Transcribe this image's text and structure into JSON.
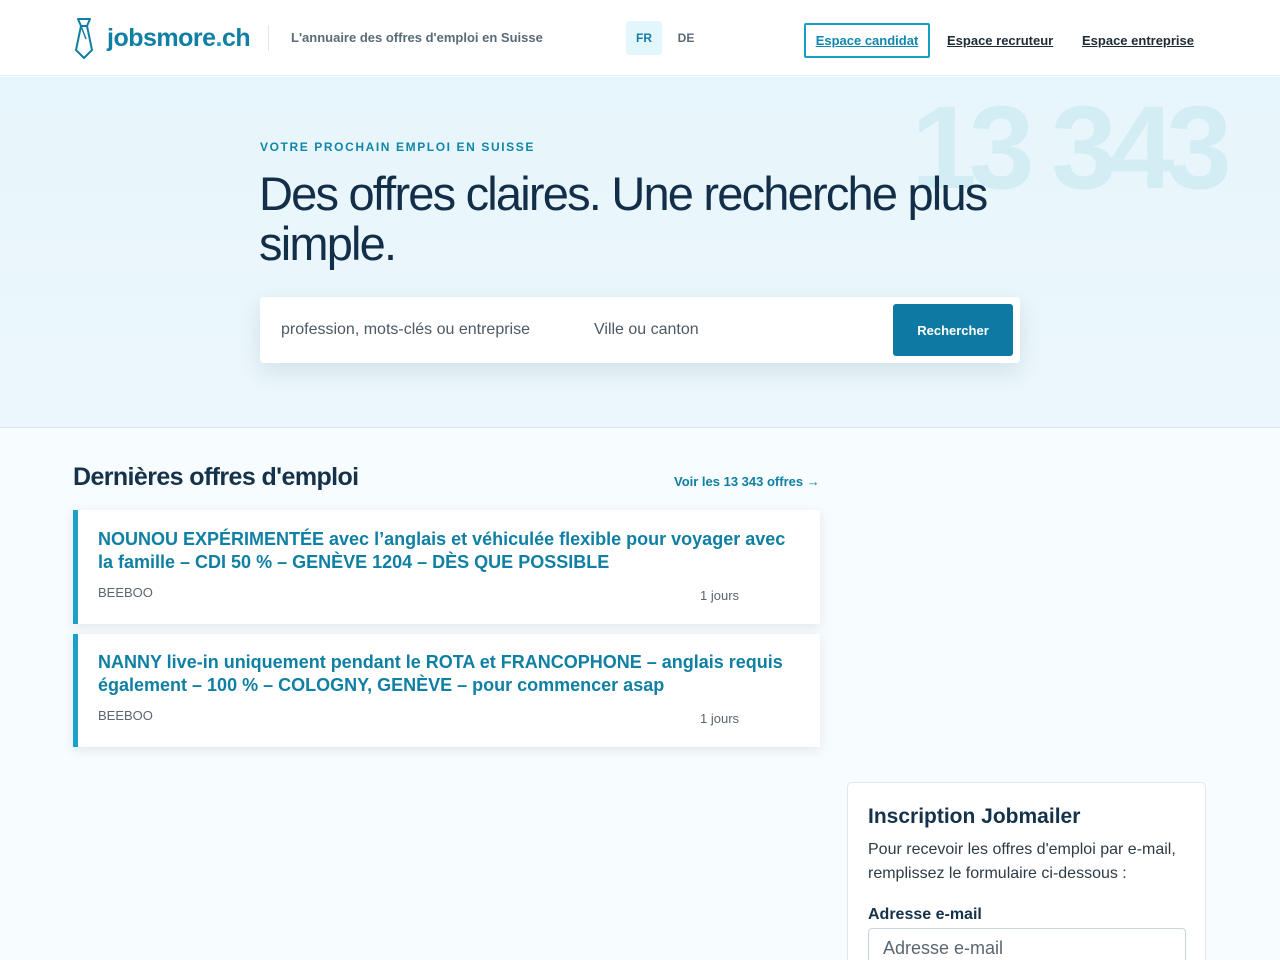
{
  "header": {
    "logo": {
      "name": "jobsmore",
      "dot": ".",
      "tld": "ch"
    },
    "tagline": "L'annuaire des offres d'emploi en Suisse",
    "languages": [
      {
        "code": "FR",
        "active": true
      },
      {
        "code": "DE",
        "active": false
      }
    ],
    "nav": {
      "candidat": "Espace candidat",
      "recruteur": "Espace recruteur",
      "entreprise": "Espace entreprise"
    }
  },
  "hero": {
    "count": "13 343",
    "eyebrow": "VOTRE PROCHAIN EMPLOI EN SUISSE",
    "title": "Des offres claires. Une recherche plus simple.",
    "search": {
      "what_placeholder": "profession, mots-clés ou entreprise",
      "where_placeholder": "Ville ou canton",
      "button": "Rechercher"
    }
  },
  "listings": {
    "title": "Dernières offres d'emploi",
    "see_all": "Voir les 13 343 offres →",
    "jobs": [
      {
        "title": "NOUNOU EXPÉRIMENTÉE avec l’anglais et véhiculée flexible pour voyager avec la famille – CDI 50 % – GENÈVE 1204 – DÈS QUE POSSIBLE",
        "company": "BEEBOO",
        "age": "1 jours"
      },
      {
        "title": "NANNY live-in uniquement pendant le ROTA et FRANCOPHONE – anglais requis également – 100 % – COLOGNY, GENÈVE – pour commencer asap",
        "company": "BEEBOO",
        "age": "1 jours"
      }
    ]
  },
  "jobmailer": {
    "title": "Inscription Jobmailer",
    "description": "Pour recevoir les offres d'emploi par e-mail, remplissez le formulaire ci-dessous :",
    "email_label": "Adresse e-mail",
    "email_placeholder": "Adresse e-mail"
  },
  "colors": {
    "brand": "#0f7fa3",
    "accent": "#1ba0c8",
    "button": "#0e7aa3",
    "heading": "#15324a"
  },
  "icons": {
    "logo": "tie-icon"
  }
}
